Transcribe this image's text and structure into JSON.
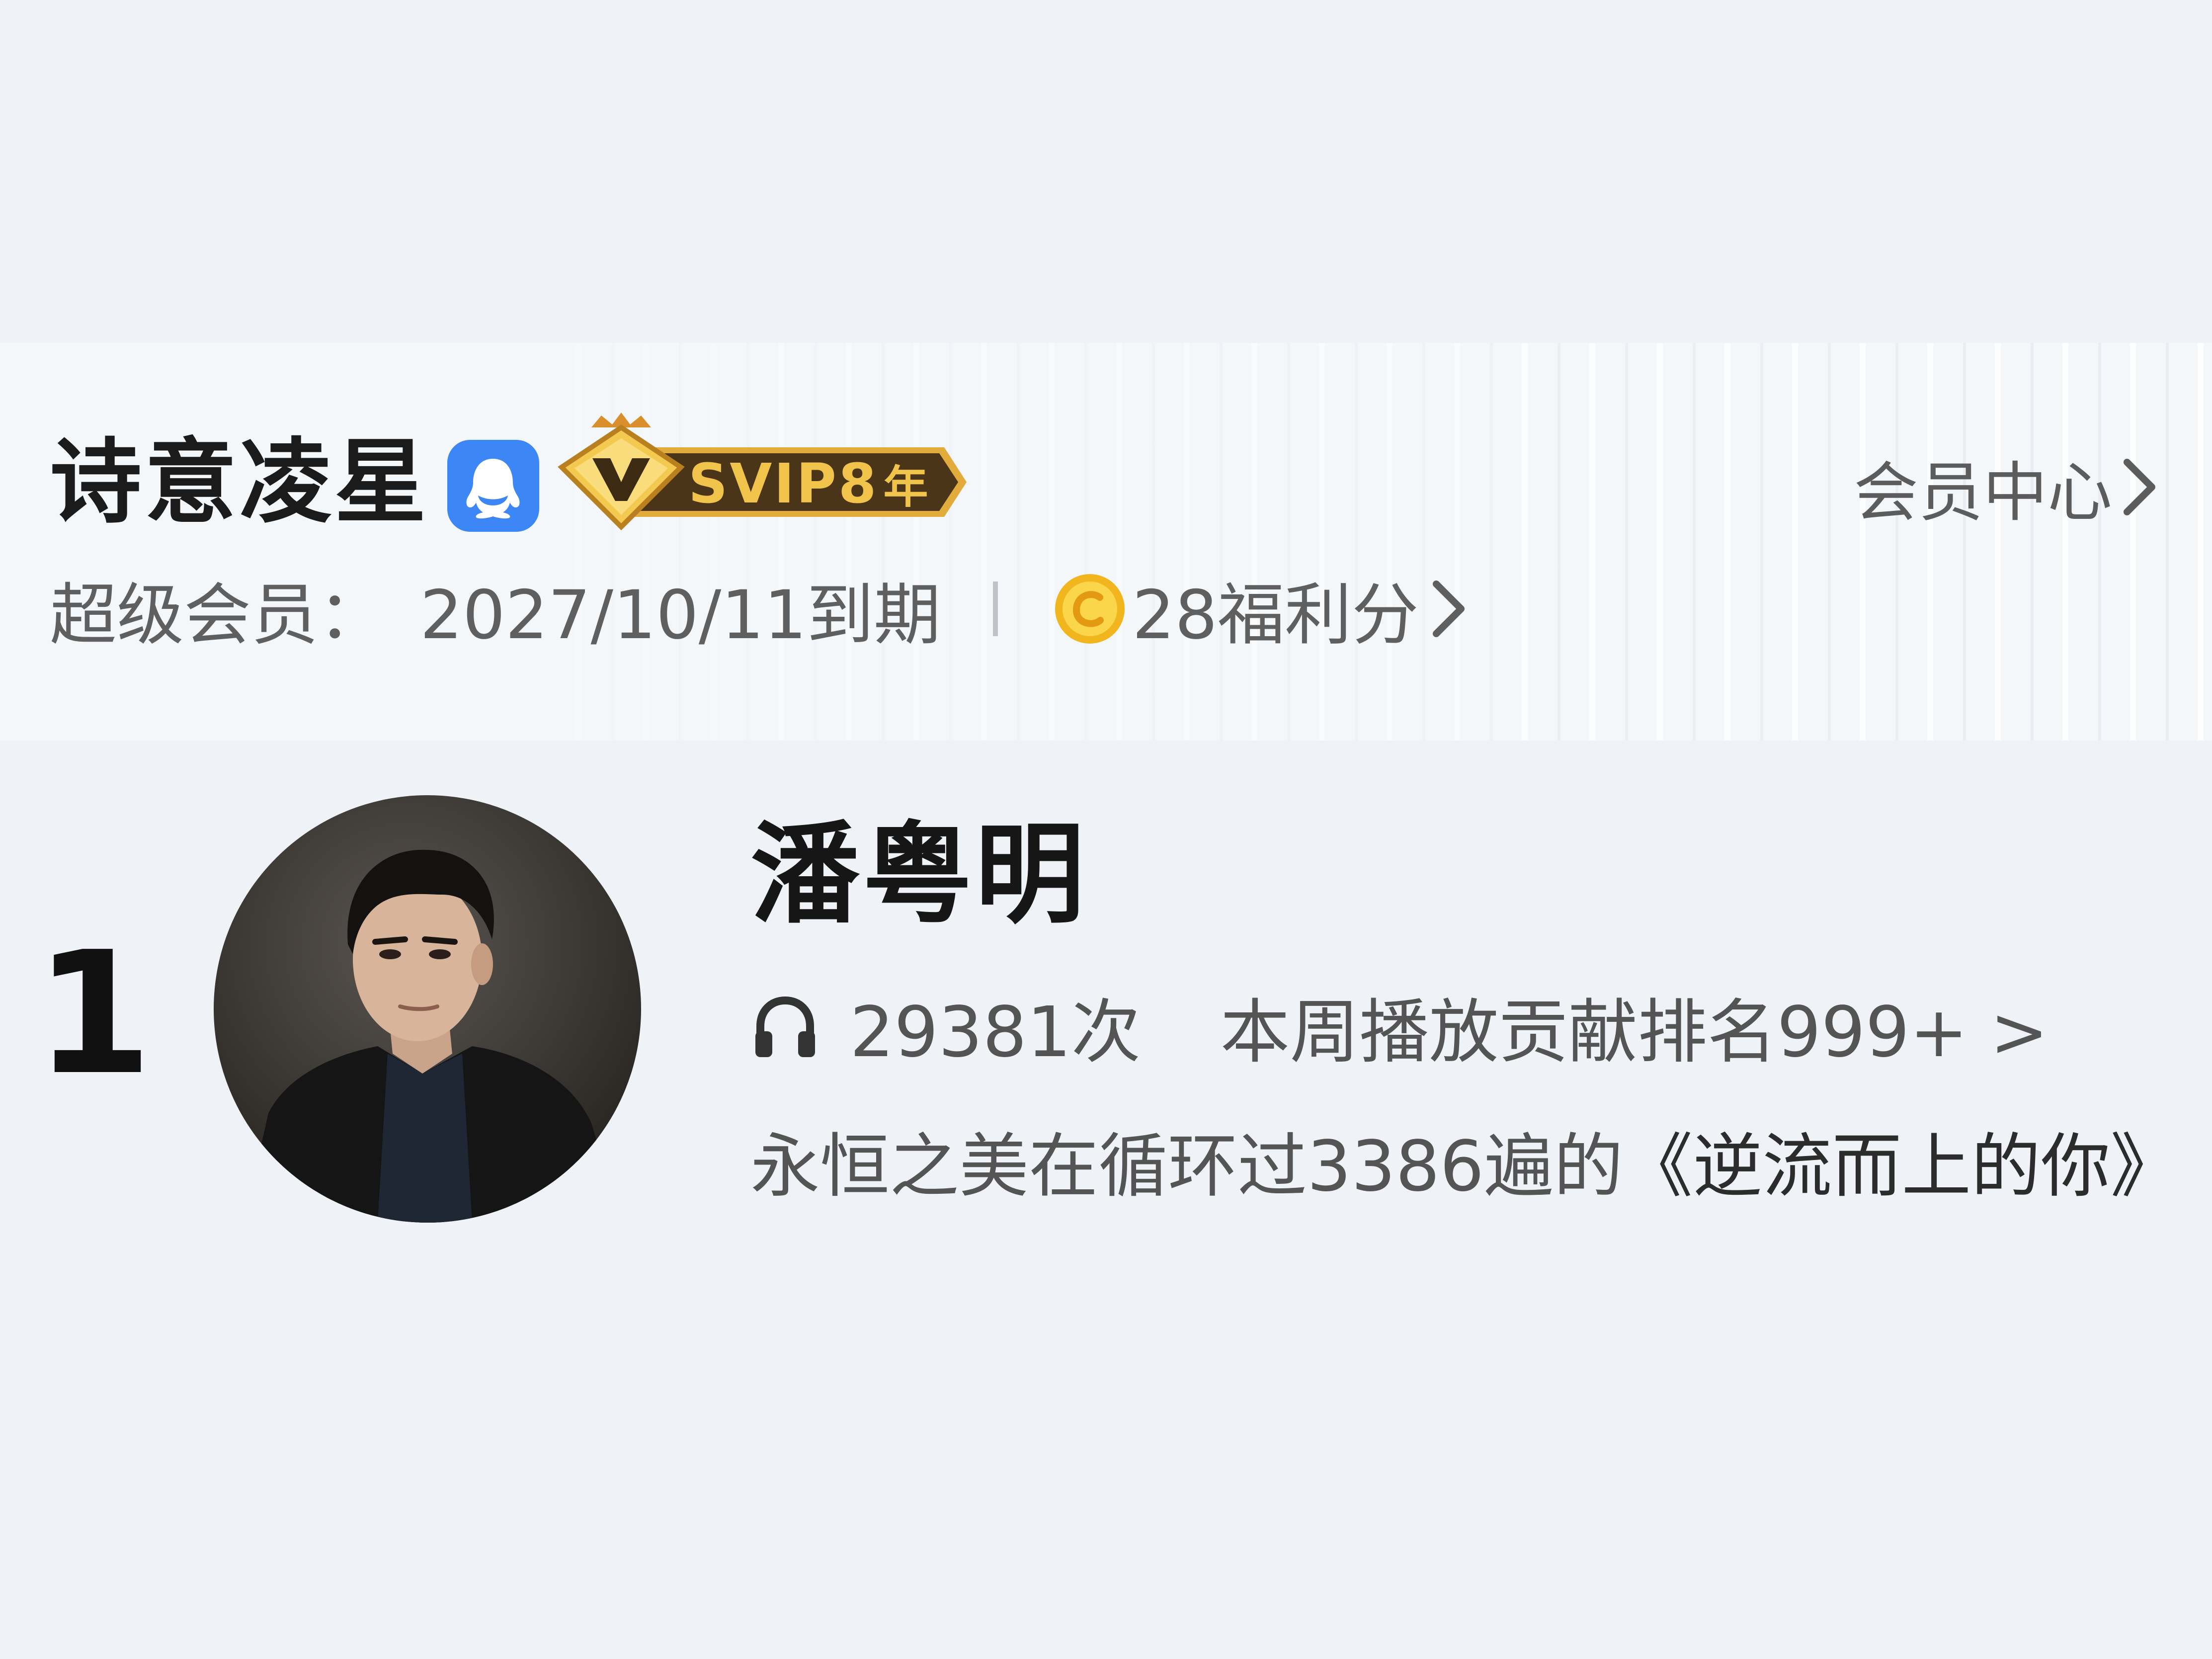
{
  "member": {
    "username": "诗意凌星",
    "svip_label": "SVIP8",
    "svip_years_label": "年",
    "member_center_label": "会员中心",
    "expire_label": "超级会员：",
    "expire_date": "2027/10/11到期",
    "points_text": "28福利分",
    "icons": {
      "qq": "qq-penguin-icon",
      "svip": "crown-diamond-v-icon",
      "coin": "gold-coin-icon",
      "chevron": "chevron-right-icon"
    },
    "colors": {
      "qq_badge": "#3d86f6",
      "svip_gold": "#f0c34a",
      "svip_ribbon": "#4a3519"
    }
  },
  "artist_rank": {
    "rank": "1",
    "artist_name": "潘粤明",
    "play_count": "29381次",
    "weekly_rank_text": "本周播放贡献排名999+ >",
    "loop_prefix": "永恒之美在循环过3386遍的",
    "song_title": "《逆流而上的你》",
    "icons": {
      "plays": "headphones-icon",
      "avatar": "artist-avatar-photo"
    }
  }
}
